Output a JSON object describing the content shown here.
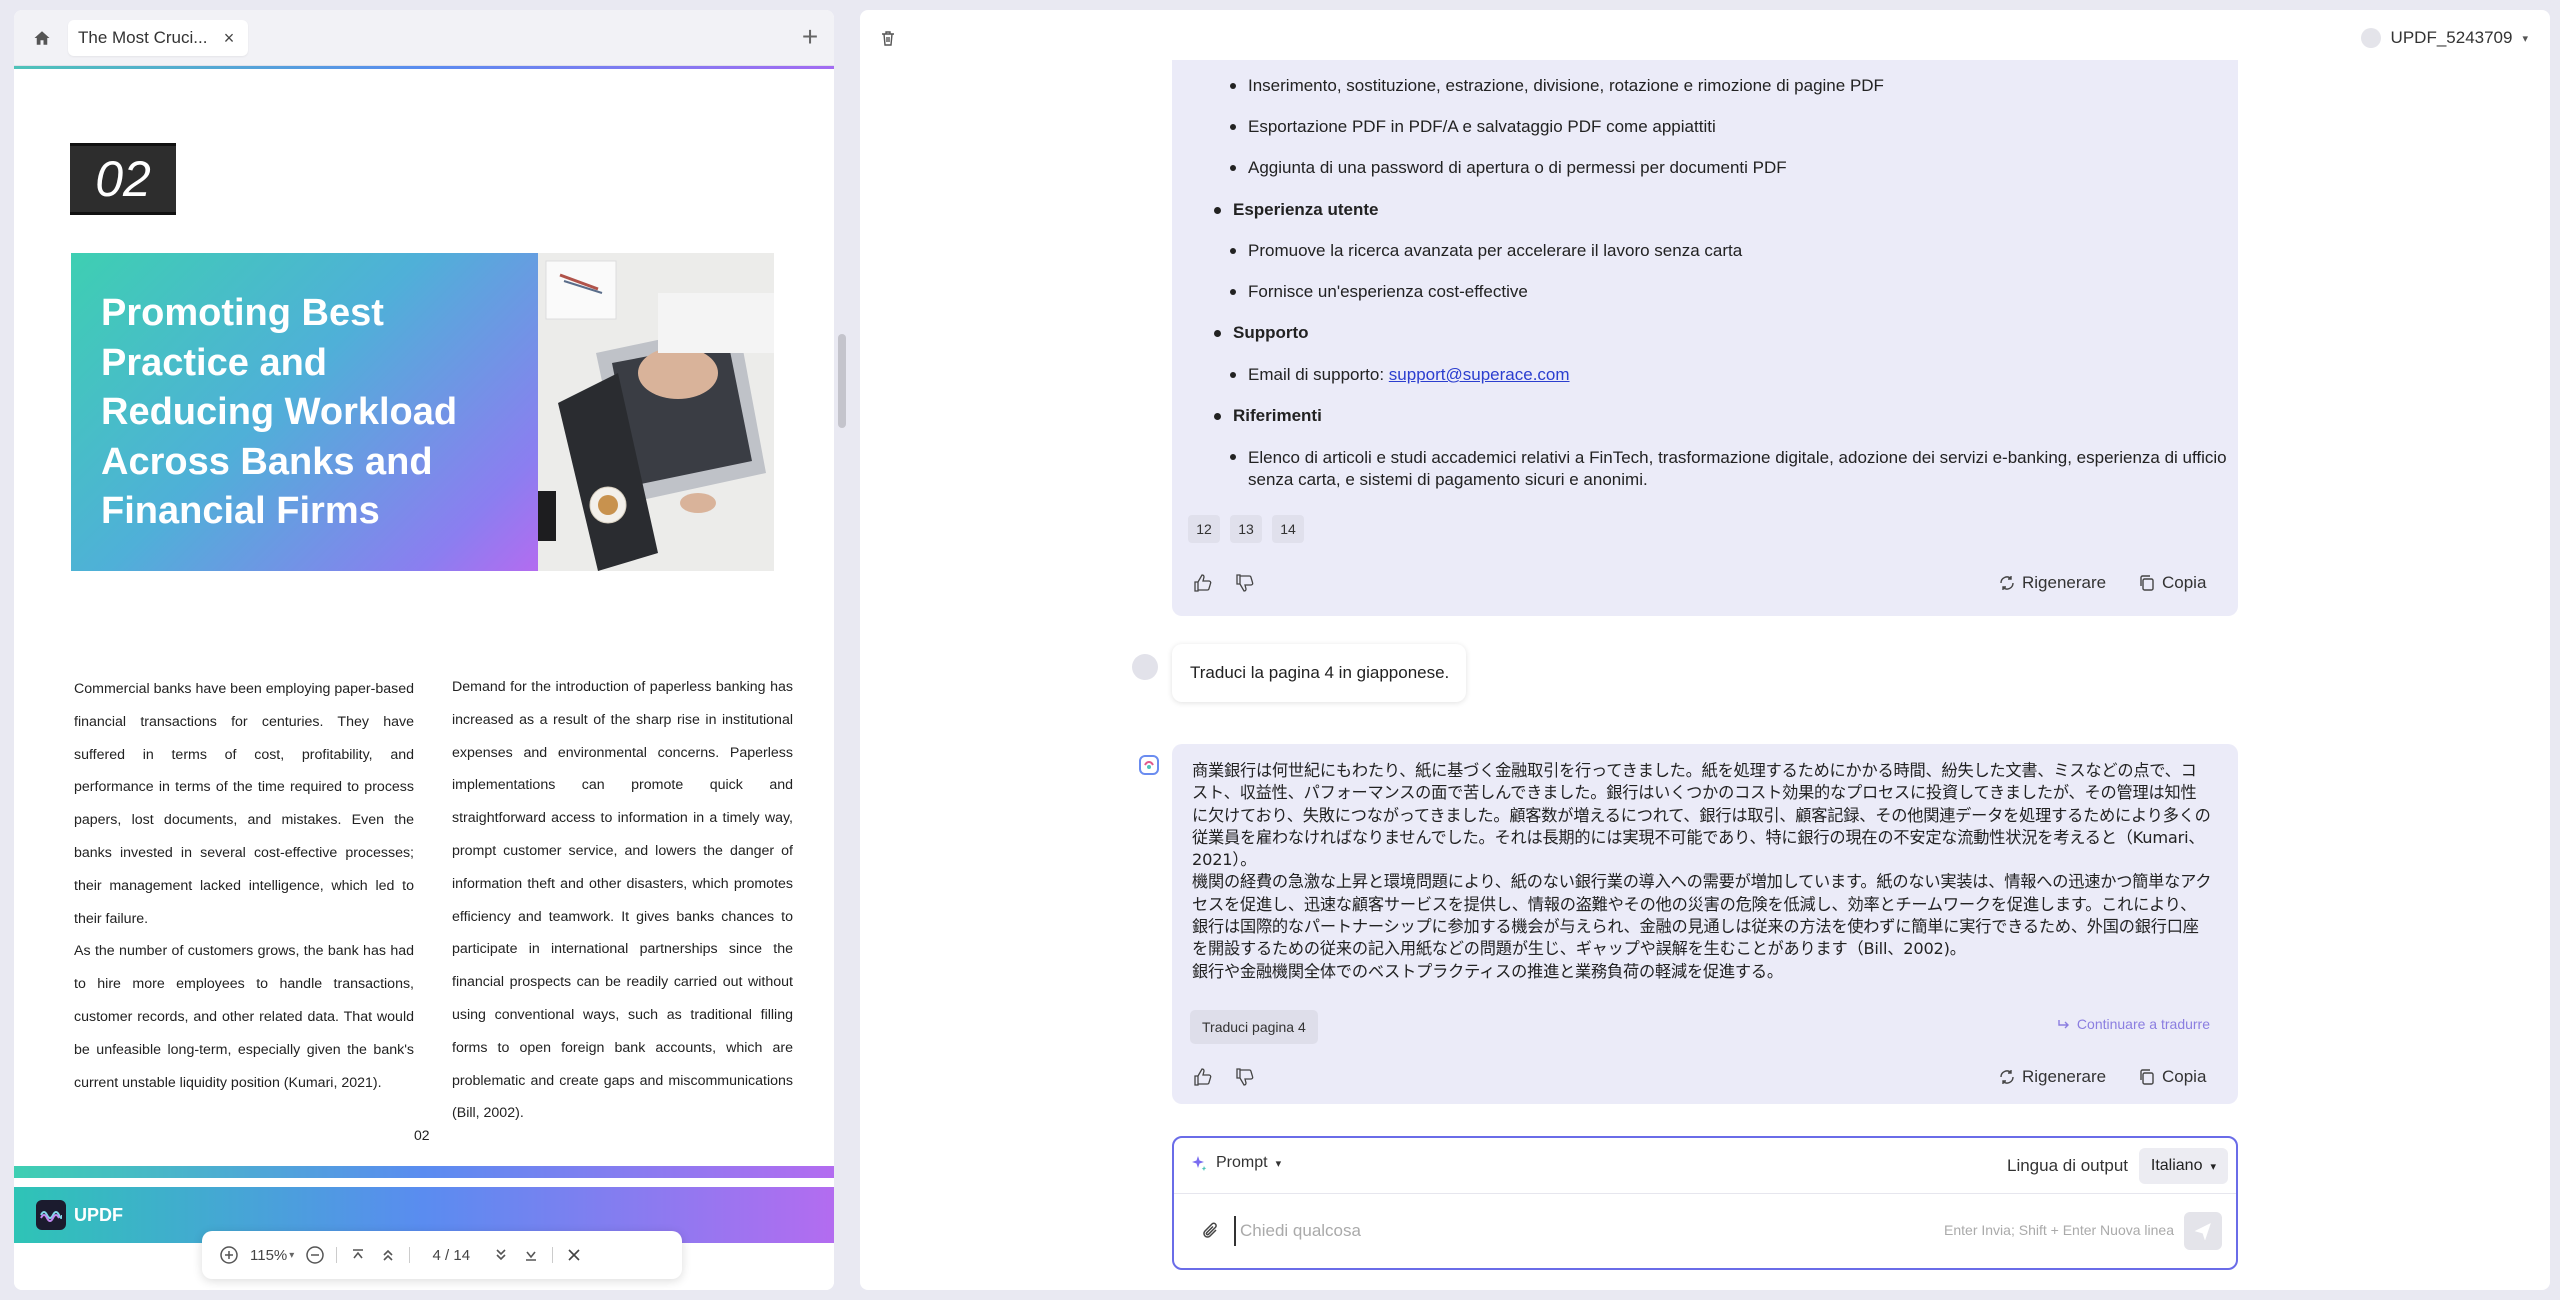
{
  "pdf": {
    "tab_title": "The Most Cruci...",
    "page_number_label": "02",
    "banner_title": "Promoting Best Practice and Reducing Workload Across Banks and Financial Firms",
    "col_left_p1": "Commercial banks have been employing paper-based financial transactions for centuries. They have suffered in terms of cost, profitability, and performance in terms of the time required to process papers, lost documents, and mistakes. Even the banks invested in several cost-effective processes; their management lacked intelligence, which led to their failure.",
    "col_left_p2": "As the number of customers grows, the bank has had to hire more employees to handle transactions, customer records, and other related data. That would be unfeasible long-term, especially given the bank's current unstable liquidity position (Kumari, 2021).",
    "col_right": "Demand for the introduction of paperless banking has increased as a result of the sharp rise in institutional expenses and environmental concerns. Paperless implementations can promote quick and straightforward access to information in a timely way, prompt customer service, and lowers the danger of information theft and other disasters, which promotes efficiency and teamwork. It gives banks chances to participate in international partnerships since the financial prospects can be readily carried out without using conventional ways, such as traditional filling forms to open foreign bank accounts, which are problematic and create gaps and miscommunications (Bill, 2002).",
    "footer_page": "02",
    "next_page_brand": "UPDF"
  },
  "toolbar": {
    "zoom": "115%",
    "current_page": "4",
    "separator": "/",
    "total_pages": "14"
  },
  "header": {
    "username": "UPDF_5243709"
  },
  "answer1": {
    "items": [
      "Inserimento, sostituzione, estrazione, divisione, rotazione e rimozione di pagine PDF",
      "Esportazione PDF in PDF/A e salvataggio PDF come appiattiti",
      "Aggiunta di una password di apertura o di permessi per documenti PDF"
    ],
    "section_ux": "Esperienza utente",
    "ux_items": [
      "Promuove la ricerca avanzata per accelerare il lavoro senza carta",
      "Fornisce un'esperienza cost-effective"
    ],
    "section_support": "Supporto",
    "support_prefix": "Email di supporto: ",
    "support_email": "support@superace.com",
    "section_refs": "Riferimenti",
    "refs_item": "Elenco di articoli e studi accademici relativi a FinTech, trasformazione digitale, adozione dei servizi e-banking, esperienza di ufficio senza carta, e sistemi di pagamento sicuri e anonimi.",
    "ref_chips": [
      "12",
      "13",
      "14"
    ],
    "regenerate": "Rigenerare",
    "copy": "Copia"
  },
  "user_message": "Traduci la pagina 4 in giapponese.",
  "answer2": {
    "jp_p1": "商業銀行は何世紀にもわたり、紙に基づく金融取引を行ってきました。紙を処理するためにかかる時間、紛失した文書、ミスなどの点で、コスト、収益性、パフォーマンスの面で苦しんできました。銀行はいくつかのコスト効果的なプロセスに投資してきましたが、その管理は知性に欠けており、失敗につながってきました。顧客数が増えるにつれて、銀行は取引、顧客記録、その他関連データを処理するためにより多くの従業員を雇わなければなりませんでした。それは長期的には実現不可能であり、特に銀行の現在の不安定な流動性状況を考えると（Kumari、2021）。",
    "jp_p2": "機関の経費の急激な上昇と環境問題により、紙のない銀行業の導入への需要が増加しています。紙のない実装は、情報への迅速かつ簡単なアクセスを促進し、迅速な顧客サービスを提供し、情報の盗難やその他の災害の危険を低減し、効率とチームワークを促進します。これにより、銀行は国際的なパートナーシップに参加する機会が与えられ、金融の見通しは従来の方法を使わずに簡単に実行できるため、外国の銀行口座を開設するための従来の記入用紙などの問題が生じ、ギャップや誤解を生むことがあります（Bill、2002)。",
    "jp_p3": "銀行や金融機関全体でのベストプラクティスの推進と業務負荷の軽減を促進する。",
    "translate_chip": "Traduci pagina 4",
    "continue": "Continuare a tradurre",
    "regenerate": "Rigenerare",
    "copy": "Copia"
  },
  "prompt": {
    "prompt_label": "Prompt",
    "output_lang_label": "Lingua di output",
    "output_lang": "Italiano",
    "placeholder": "Chiedi qualcosa",
    "hint": "Enter Invia; Shift + Enter Nuova linea"
  },
  "colors": {
    "accent": "#6a6ce8",
    "ai_card_bg": "#ebebf8",
    "link": "#2b3ecf"
  }
}
